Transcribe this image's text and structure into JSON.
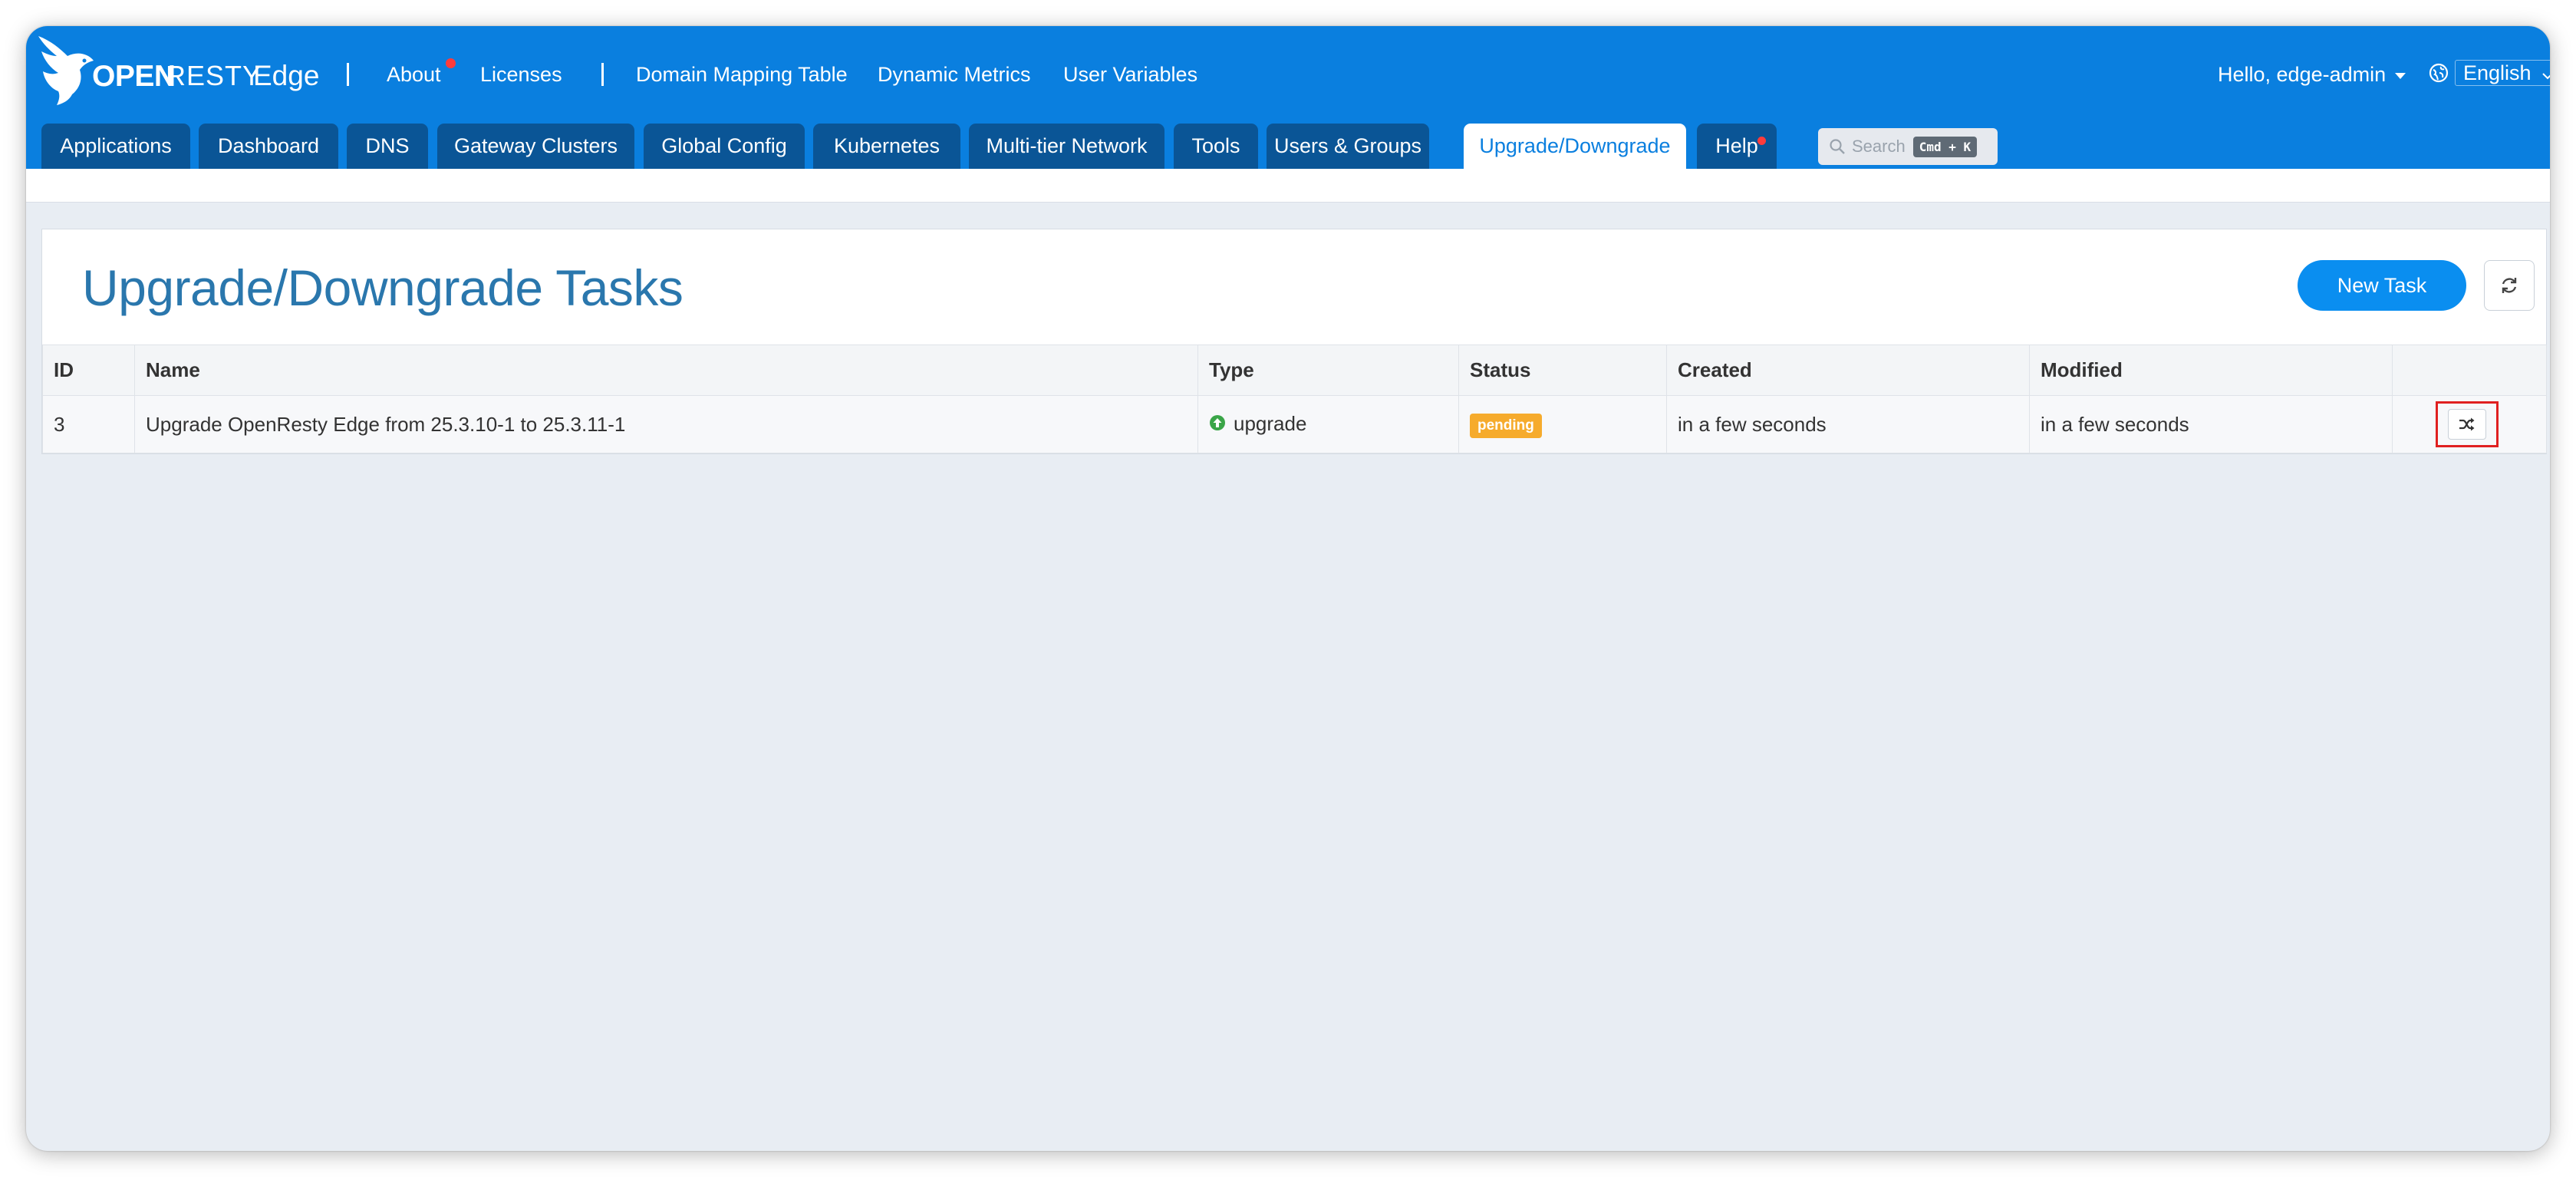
{
  "brand": {
    "open": "OPEN",
    "resty": "RESTY",
    "product": "Edge"
  },
  "topnav": {
    "about": "About",
    "licenses": "Licenses",
    "domain_mapping": "Domain Mapping Table",
    "dynamic_metrics": "Dynamic Metrics",
    "user_variables": "User Variables"
  },
  "user": {
    "greeting": "Hello, edge-admin",
    "language": "English"
  },
  "tabs": [
    "Applications",
    "Dashboard",
    "DNS",
    "Gateway Clusters",
    "Global Config",
    "Kubernetes",
    "Multi-tier Network",
    "Tools",
    "Users & Groups",
    "Upgrade/Downgrade",
    "Help"
  ],
  "active_tab": "Upgrade/Downgrade",
  "search": {
    "placeholder": "Search",
    "shortcut": "Cmd + K"
  },
  "page": {
    "title": "Upgrade/Downgrade Tasks",
    "new_task_label": "New Task"
  },
  "table": {
    "columns": [
      "ID",
      "Name",
      "Type",
      "Status",
      "Created",
      "Modified",
      ""
    ],
    "rows": [
      {
        "id": "3",
        "name": "Upgrade OpenResty Edge from 25.3.10-1 to 25.3.11-1",
        "type": "upgrade",
        "status": "pending",
        "created": "in a few seconds",
        "modified": "in a few seconds"
      }
    ]
  },
  "colors": {
    "header": "#0a7fdf",
    "tab": "#0a5596",
    "title": "#2a77ad",
    "button": "#0a8ef0",
    "pending": "#f6ab2c",
    "upgrade_icon": "#3aa548",
    "notify_dot": "#ff3b3b",
    "highlight": "#e02020"
  },
  "icons": {
    "upgrade": "arrow-up-circle-icon",
    "action": "shuffle-icon",
    "refresh": "refresh-icon",
    "search": "search-icon",
    "language": "globe-icon"
  }
}
